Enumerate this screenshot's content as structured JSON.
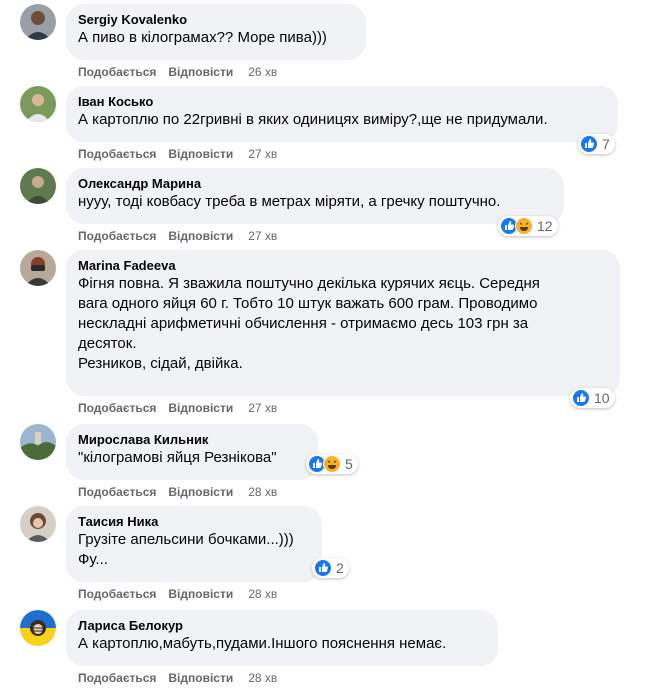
{
  "labels": {
    "like": "Подобається",
    "reply": "Відповісти"
  },
  "colors": {
    "like_blue": "#1877f2",
    "haha_yellow": "#f7b125",
    "bubble": "#f0f2f5",
    "meta_gray": "#65676b"
  },
  "comments": [
    {
      "author": "Sergiy Kovalenko",
      "lines": [
        "А пиво в кілограмах?? Море пива)))"
      ],
      "time": "26 хв",
      "reactions": null,
      "reaction_icons": []
    },
    {
      "author": "Іван Косько",
      "lines": [
        "А картоплю по 22гривні в яких одиницях виміру?,ще не придумали."
      ],
      "time": "27 хв",
      "reactions": "7",
      "reaction_icons": [
        "like-icon"
      ]
    },
    {
      "author": "Олександр Марина",
      "lines": [
        "нууу, тоді ковбасу треба в метрах міряти, а гречку поштучно."
      ],
      "time": "27 хв",
      "reactions": "12",
      "reaction_icons": [
        "like-icon",
        "haha-icon"
      ]
    },
    {
      "author": "Marina Fadeeva",
      "lines": [
        "Фігня повна. Я зважила поштучно декілька курячих яєць. Середня",
        "вага одного яйця 60 г. Тобто 10 штук важать 600 грам. Проводимо",
        "нескладні арифметичні обчислення - отримаємо десь 103 грн за",
        "десяток.",
        "Резников, сідай, двійка."
      ],
      "time": "27 хв",
      "reactions": "10",
      "reaction_icons": [
        "like-icon"
      ]
    },
    {
      "author": "Мирослава Кильник",
      "lines": [
        "\"кілограмові яйця Резнікова\""
      ],
      "time": "28 хв",
      "reactions": "5",
      "reaction_icons": [
        "like-icon",
        "haha-icon"
      ]
    },
    {
      "author": "Таисия Ника",
      "lines": [
        "Грузіте апельсини бочками...)))",
        "Фу..."
      ],
      "time": "28 хв",
      "reactions": "2",
      "reaction_icons": [
        "like-icon"
      ]
    },
    {
      "author": "Лариса Белокур",
      "lines": [
        "А картоплю,мабуть,пудами.Іншого пояснення немає."
      ],
      "time": "28 хв",
      "reactions": null,
      "reaction_icons": []
    }
  ]
}
